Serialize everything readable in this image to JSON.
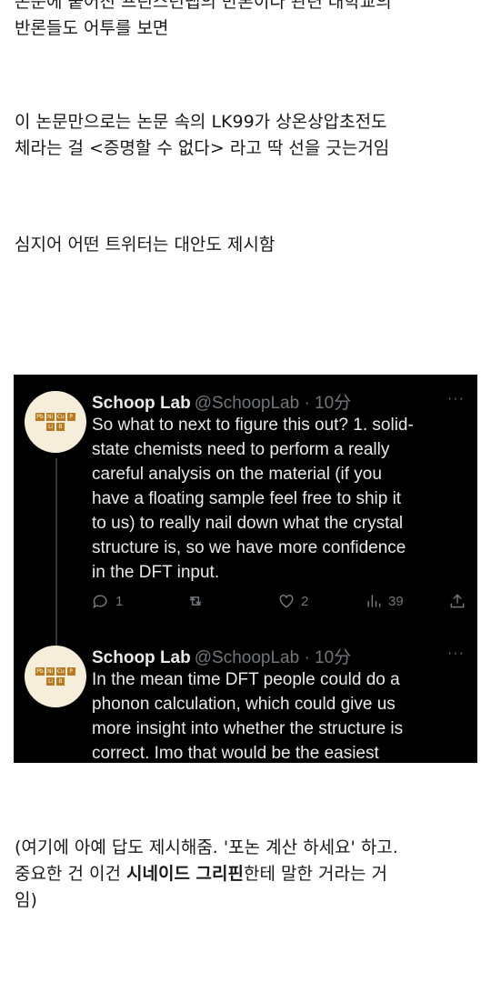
{
  "paragraphs": [
    "논문에 붙어진 프린스턴랩의 반론이다 관련 대학교의\n반론들도 어투를 보면",
    "이 논문만으로는 논문 속의 LK99가 상온상압초전도\n체라는 걸 <증명할 수 없다> 라고 딱 선을 긋는거임",
    "심지어 어떤 트위터는 대안도 제시함"
  ],
  "closing": {
    "part1": "(여기에 아예 답도 제시해줌. '포논 계산 하세요' 하고.\n중요한 건 이건 ",
    "bold": "시네이드 그리핀",
    "part2": "한테 말한 거라는 거\n임)"
  },
  "logo": {
    "row1": [
      "Pb",
      "Ni",
      "Cu",
      "P"
    ],
    "row2": [
      "Li",
      "B"
    ]
  },
  "tweets": [
    {
      "name": "Schoop Lab",
      "handle": "@SchoopLab · 10分",
      "more": "···",
      "text": "So what to next to figure this out? 1. solid-\nstate chemists need to perform a really\ncareful analysis on the material (if you\nhave a floating sample feel free to ship it\nto us) to really nail down what the crystal\nstructure is, so we have more confidence\nin the DFT input.",
      "replies": "1",
      "retweets": "",
      "likes": "2",
      "views": "39"
    },
    {
      "name": "Schoop Lab",
      "handle": "@SchoopLab · 10分",
      "more": "···",
      "text": "In the mean time DFT people could do a\nphonon calculation, which could give us\nmore insight into whether the structure is\ncorrect. Imo that would be the easiest"
    }
  ],
  "icons": [
    "reply-icon",
    "retweet-icon",
    "like-icon",
    "views-icon",
    "share-icon",
    "more-icon"
  ],
  "colors": {
    "tweet_bg": "#000000",
    "tweet_text": "#e7e9ea",
    "muted": "#71767b",
    "logo": "#b87b24"
  }
}
